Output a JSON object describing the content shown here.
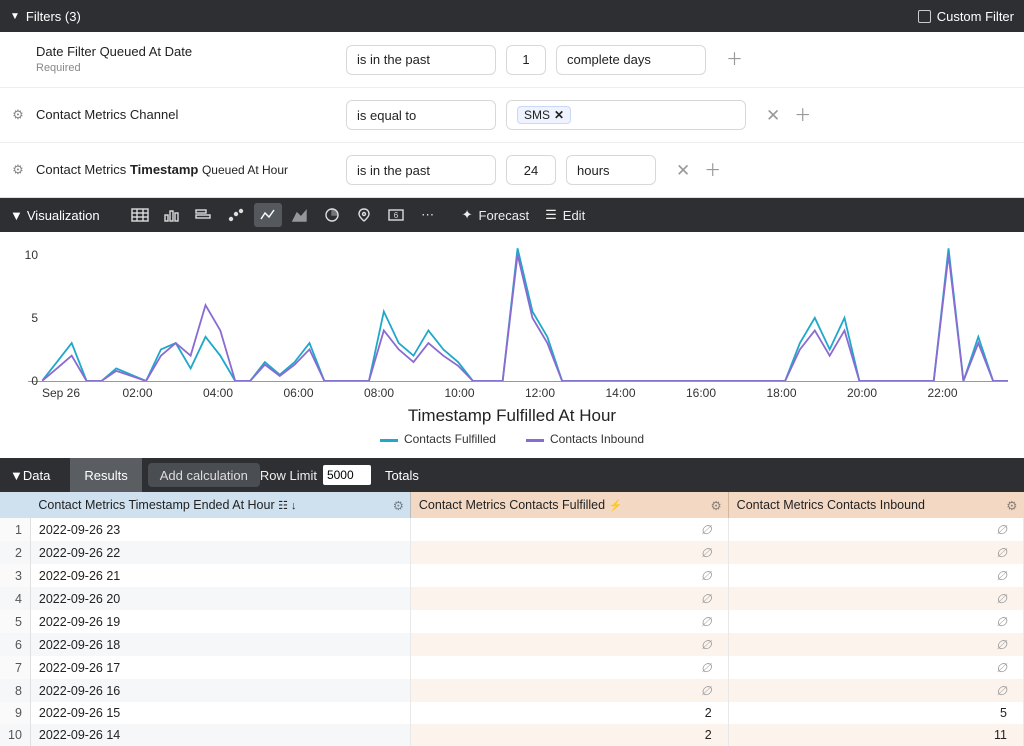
{
  "filters": {
    "header": "Filters (3)",
    "custom_label": "Custom Filter",
    "rows": [
      {
        "name": "Date Filter Queued At Date",
        "required": "Required",
        "op": "is in the past",
        "num": "1",
        "unit": "complete days",
        "removable": false
      },
      {
        "name": "Contact Metrics Channel",
        "op": "is equal to",
        "tag": "SMS",
        "removable": true
      },
      {
        "name_prefix": "Contact Metrics",
        "name_bold": "Timestamp",
        "name_suffix": "Queued At Hour",
        "op": "is in the past",
        "num": "24",
        "unit": "hours",
        "removable": true
      }
    ]
  },
  "viz": {
    "header": "Visualization",
    "forecast": "Forecast",
    "edit": "Edit"
  },
  "chart_data": {
    "type": "line",
    "title": "Timestamp Fulfilled At Hour",
    "xlabel": "",
    "ylabel": "",
    "ylim": [
      0,
      11
    ],
    "y_ticks": [
      0,
      5,
      10
    ],
    "x_ticks": [
      "Sep 26",
      "02:00",
      "04:00",
      "06:00",
      "08:00",
      "10:00",
      "12:00",
      "14:00",
      "16:00",
      "18:00",
      "20:00",
      "22:00"
    ],
    "series": [
      {
        "name": "Contacts Fulfilled",
        "color": "#1fa8c9",
        "values": [
          0,
          1.5,
          3,
          0,
          0,
          1,
          0.5,
          0,
          2.5,
          3,
          1,
          3.5,
          2,
          0,
          0,
          1.5,
          0.5,
          1.5,
          3,
          0,
          0,
          0,
          0,
          5.5,
          3,
          2,
          4,
          2.5,
          1.5,
          0,
          0,
          0,
          10.5,
          5.5,
          3.5,
          0,
          0,
          0,
          0,
          0,
          0,
          0,
          0,
          0,
          0,
          0,
          0,
          0,
          0,
          0,
          0,
          3,
          5,
          2.5,
          5,
          0,
          0,
          0,
          0,
          0,
          0,
          10.5,
          0,
          3.5,
          0,
          0
        ]
      },
      {
        "name": "Contacts Inbound",
        "color": "#8a6bd1",
        "values": [
          0,
          1,
          2,
          0,
          0,
          0.8,
          0.4,
          0,
          2,
          3,
          2,
          6,
          4,
          0,
          0,
          1.3,
          0.4,
          1.3,
          2.5,
          0,
          0,
          0,
          0,
          4,
          2.5,
          1.5,
          3,
          2,
          1.2,
          0,
          0,
          0,
          10,
          5,
          3,
          0,
          0,
          0,
          0,
          0,
          0,
          0,
          0,
          0,
          0,
          0,
          0,
          0,
          0,
          0,
          0,
          2.5,
          4,
          2,
          4,
          0,
          0,
          0,
          0,
          0,
          0,
          10,
          0,
          3,
          0,
          0
        ]
      }
    ]
  },
  "data": {
    "header": "Data",
    "tab_results": "Results",
    "tab_addcalc": "Add calculation",
    "row_limit_label": "Row Limit",
    "row_limit_value": "5000",
    "totals_label": "Totals",
    "columns": [
      "Contact Metrics Timestamp Ended At Hour",
      "Contact Metrics Contacts Fulfilled",
      "Contact Metrics Contacts Inbound"
    ],
    "rows": [
      {
        "idx": 1,
        "ts": "2022-09-26 23",
        "fulfilled": null,
        "inbound": null
      },
      {
        "idx": 2,
        "ts": "2022-09-26 22",
        "fulfilled": null,
        "inbound": null
      },
      {
        "idx": 3,
        "ts": "2022-09-26 21",
        "fulfilled": null,
        "inbound": null
      },
      {
        "idx": 4,
        "ts": "2022-09-26 20",
        "fulfilled": null,
        "inbound": null
      },
      {
        "idx": 5,
        "ts": "2022-09-26 19",
        "fulfilled": null,
        "inbound": null
      },
      {
        "idx": 6,
        "ts": "2022-09-26 18",
        "fulfilled": null,
        "inbound": null
      },
      {
        "idx": 7,
        "ts": "2022-09-26 17",
        "fulfilled": null,
        "inbound": null
      },
      {
        "idx": 8,
        "ts": "2022-09-26 16",
        "fulfilled": null,
        "inbound": null
      },
      {
        "idx": 9,
        "ts": "2022-09-26 15",
        "fulfilled": 2,
        "inbound": 5
      },
      {
        "idx": 10,
        "ts": "2022-09-26 14",
        "fulfilled": 2,
        "inbound": 11
      }
    ]
  }
}
